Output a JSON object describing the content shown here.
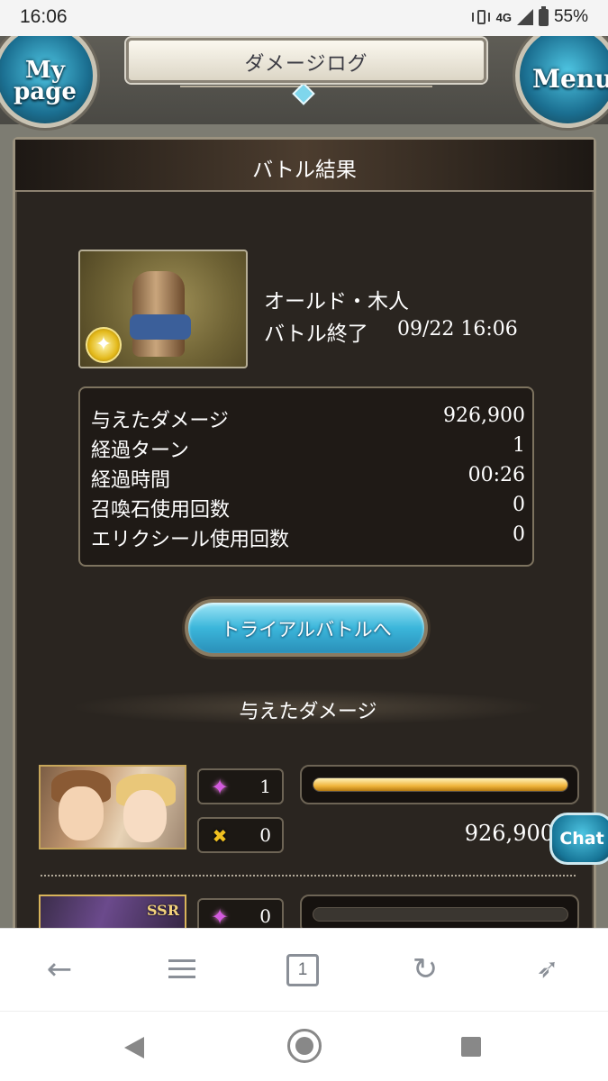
{
  "status_bar": {
    "time": "16:06",
    "network": "4G",
    "battery": "55%"
  },
  "header": {
    "title": "ダメージログ",
    "mypage_line1": "My",
    "mypage_line2": "page",
    "menu_label": "Menu"
  },
  "panel": {
    "title": "バトル結果",
    "boss": {
      "name": "オールド・木人",
      "status": "バトル終了",
      "datetime": "09/22 16:06"
    },
    "stats": [
      {
        "label": "与えたダメージ",
        "value": "926,900"
      },
      {
        "label": "経過ターン",
        "value": "1"
      },
      {
        "label": "経過時間",
        "value": "00:26"
      },
      {
        "label": "召喚石使用回数",
        "value": "0"
      },
      {
        "label": "エリクシール使用回数",
        "value": "0"
      }
    ],
    "trial_button": "トライアルバトルへ",
    "damage_section_title": "与えたダメージ",
    "characters": [
      {
        "star_count": "1",
        "skill_count": "0",
        "damage": "926,900",
        "damage_fraction": 1.0
      },
      {
        "badge": "SSR",
        "star_count": "0",
        "damage_fraction": 0.0
      }
    ]
  },
  "chat_button": "Chat",
  "browser_toolbar": {
    "tab_count": "1"
  },
  "icons": [
    "vibrate-icon",
    "signal-icon",
    "battery-icon",
    "crystal-star-icon",
    "skill-icon",
    "back-arrow-icon",
    "menu-icon",
    "tabs-icon",
    "reload-icon",
    "rocket-icon"
  ]
}
